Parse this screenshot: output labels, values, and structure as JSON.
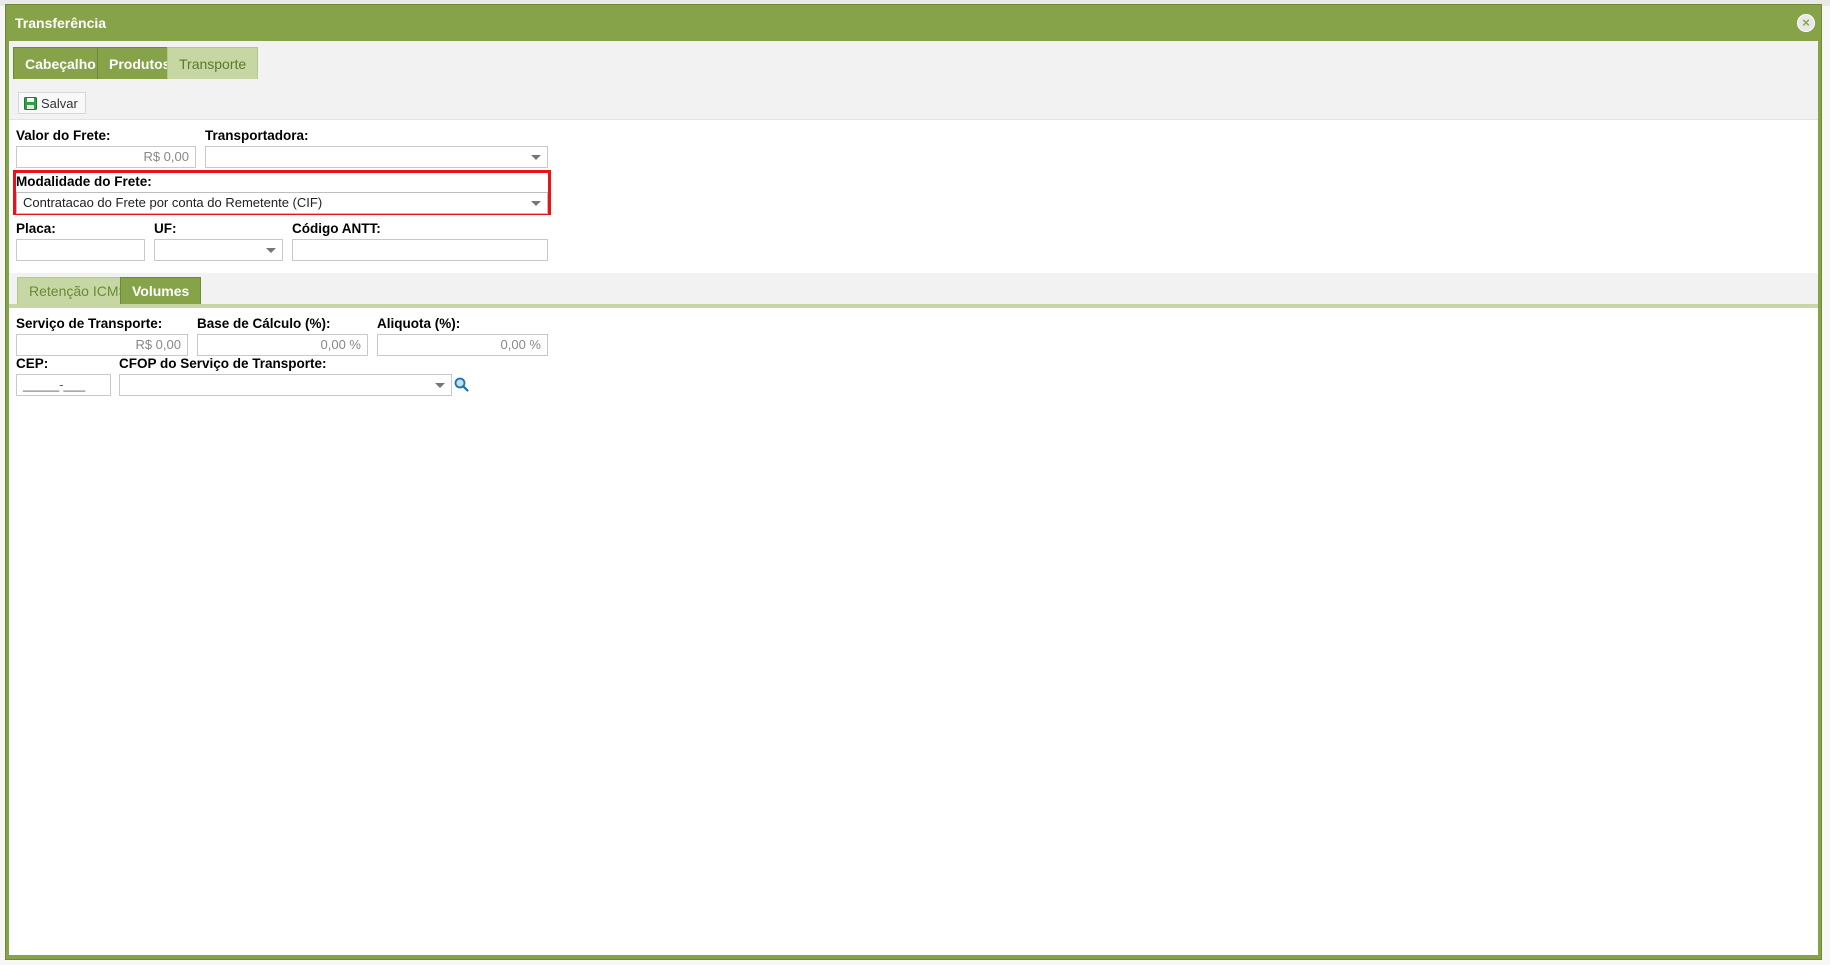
{
  "window": {
    "title": "Transferência",
    "close_icon": "close-icon"
  },
  "tabs": [
    {
      "label": "Cabeçalho",
      "active": false
    },
    {
      "label": "Produtos",
      "active": false
    },
    {
      "label": "Transporte",
      "active": true
    }
  ],
  "toolbar": {
    "save_label": "Salvar",
    "save_icon": "save-icon"
  },
  "form": {
    "valor_frete": {
      "label": "Valor do Frete:",
      "value": "R$ 0,00"
    },
    "transportadora": {
      "label": "Transportadora:",
      "value": ""
    },
    "modalidade": {
      "label": "Modalidade do Frete:",
      "value": "Contratacao do Frete por conta do Remetente (CIF)"
    },
    "placa": {
      "label": "Placa:",
      "value": ""
    },
    "uf": {
      "label": "UF:",
      "value": ""
    },
    "antt": {
      "label": "Código ANTT:",
      "value": ""
    }
  },
  "subtabs": [
    {
      "label": "Retenção ICMS",
      "active": false
    },
    {
      "label": "Volumes",
      "active": true
    }
  ],
  "retencao": {
    "servico": {
      "label": "Serviço de Transporte:",
      "value": "R$ 0,00"
    },
    "base": {
      "label": "Base de Cálculo (%):",
      "value": "0,00 %"
    },
    "aliquota": {
      "label": "Aliquota (%):",
      "value": "0,00 %"
    },
    "cep": {
      "label": "CEP:",
      "value": "_____-___"
    },
    "cfop": {
      "label": "CFOP do Serviço de Transporte:",
      "value": ""
    }
  },
  "colors": {
    "accent": "#86a34a",
    "accent_light": "#c6d7a3",
    "highlight": "#e8141c"
  }
}
